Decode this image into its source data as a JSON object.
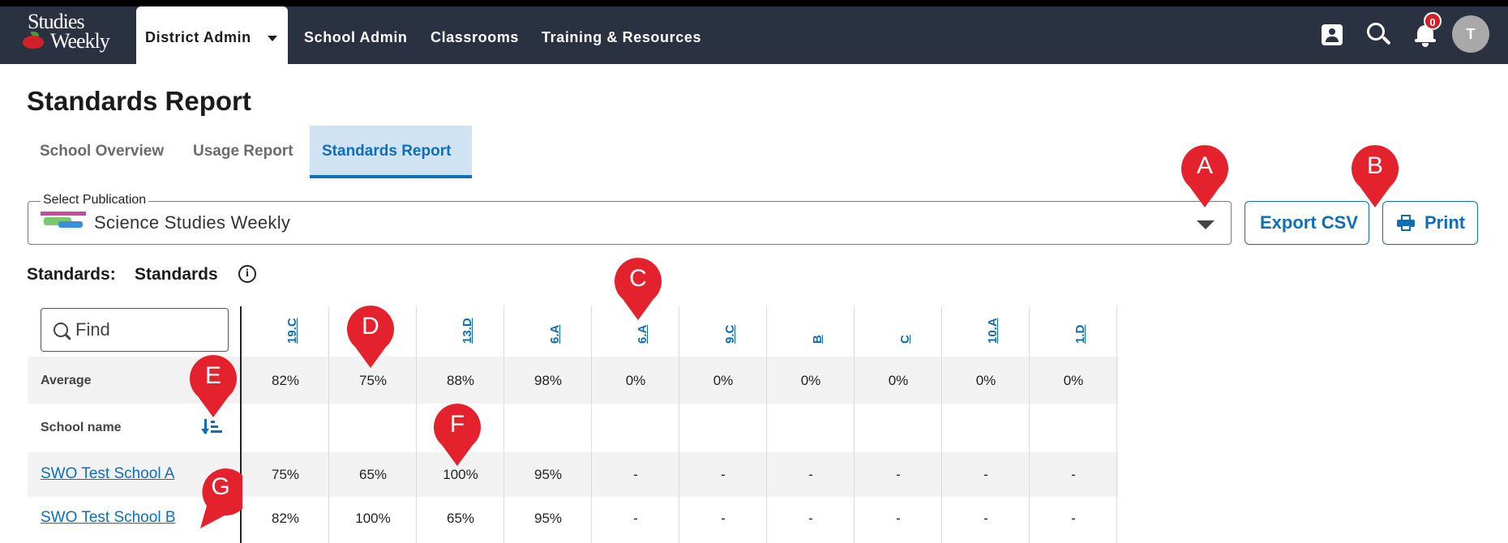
{
  "nav": {
    "logo_line1": "Studies",
    "logo_line2": "Weekly",
    "district_admin": "District Admin",
    "school_admin": "School Admin",
    "classrooms": "Classrooms",
    "training": "Training & Resources",
    "notification_count": "0",
    "avatar_initial": "T"
  },
  "page": {
    "title": "Standards Report",
    "tabs": [
      {
        "label": "School Overview",
        "active": false
      },
      {
        "label": "Usage Report",
        "active": false
      },
      {
        "label": "Standards Report",
        "active": true
      }
    ]
  },
  "publication": {
    "legend": "Select Publication",
    "value": "Science Studies Weekly"
  },
  "buttons": {
    "export_csv": "Export CSV",
    "print": "Print"
  },
  "standards": {
    "label": "Standards:",
    "value": "Standards",
    "info_glyph": "i"
  },
  "table": {
    "find_placeholder": "Find",
    "average_label": "Average",
    "school_name_label": "School name",
    "columns": [
      "19.C",
      "5.B",
      "13.D",
      "6.A",
      "6.A",
      "9.C",
      "B",
      "C",
      "10.A",
      "1.D"
    ],
    "average": [
      "82%",
      "75%",
      "88%",
      "98%",
      "0%",
      "0%",
      "0%",
      "0%",
      "0%",
      "0%"
    ],
    "rows": [
      {
        "school": "SWO Test School A",
        "values": [
          "75%",
          "65%",
          "100%",
          "95%",
          "-",
          "-",
          "-",
          "-",
          "-",
          "-"
        ]
      },
      {
        "school": "SWO Test School B",
        "values": [
          "82%",
          "100%",
          "65%",
          "95%",
          "-",
          "-",
          "-",
          "-",
          "-",
          "-"
        ]
      }
    ]
  },
  "markers": [
    "A",
    "B",
    "C",
    "D",
    "E",
    "F",
    "G"
  ],
  "colors": {
    "nav_bg": "#2a3140",
    "accent": "#0e6eb8",
    "active_tab_bg": "#cfe3f3",
    "marker_red": "#e3222e",
    "badge_red": "#d0202a"
  }
}
